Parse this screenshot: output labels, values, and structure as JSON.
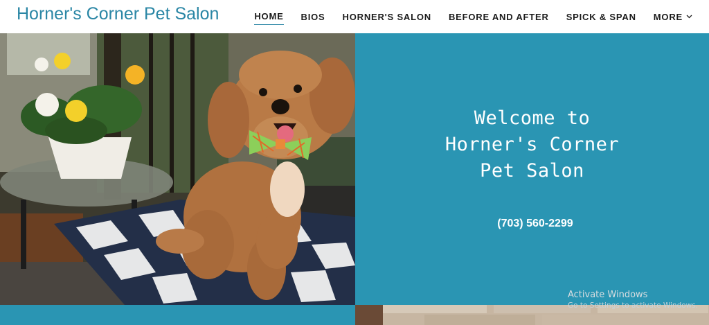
{
  "header": {
    "site_title": "Horner's Corner Pet Salon",
    "nav": [
      {
        "label": "HOME",
        "active": true
      },
      {
        "label": "BIOS"
      },
      {
        "label": "HORNER'S SALON"
      },
      {
        "label": "BEFORE AND AFTER"
      },
      {
        "label": "SPICK & SPAN"
      },
      {
        "label": "MORE"
      }
    ]
  },
  "hero": {
    "heading_lines": [
      "Welcome to",
      "Horner's Corner",
      "Pet Salon"
    ],
    "phone": "(703) 560-2299",
    "photo_alt": "Apricot toy poodle wearing a plaid bow tie sitting on a checkered cushion"
  },
  "watermark": {
    "line1": "Activate Windows",
    "line2": "Go to Settings to activate Windows."
  },
  "colors": {
    "accent": "#2a86a5",
    "panel": "#2a95b3"
  }
}
